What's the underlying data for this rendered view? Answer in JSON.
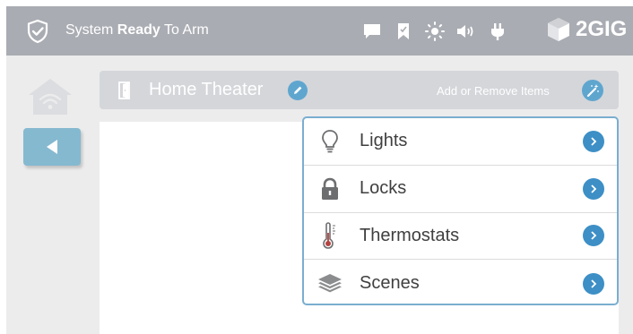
{
  "status_bar": {
    "status_prefix": "System ",
    "status_bold": "Ready",
    "status_suffix": " To Arm",
    "icons": [
      "message-icon",
      "bookmark-icon",
      "brightness-icon",
      "volume-icon",
      "power-plug-icon"
    ],
    "brand": "2GIG"
  },
  "room_bar": {
    "room_name": "Home Theater",
    "add_remove_label": "Add or Remove Items"
  },
  "menu": {
    "items": [
      {
        "label": "Lights",
        "icon": "lightbulb-icon"
      },
      {
        "label": "Locks",
        "icon": "padlock-icon"
      },
      {
        "label": "Thermostats",
        "icon": "thermometer-icon"
      },
      {
        "label": "Scenes",
        "icon": "layers-icon"
      }
    ]
  },
  "colors": {
    "top_bar": "#a9acb2",
    "accent_blue": "#3d8fc6",
    "back_button": "#85b9d0",
    "menu_border": "#7aaed0"
  }
}
